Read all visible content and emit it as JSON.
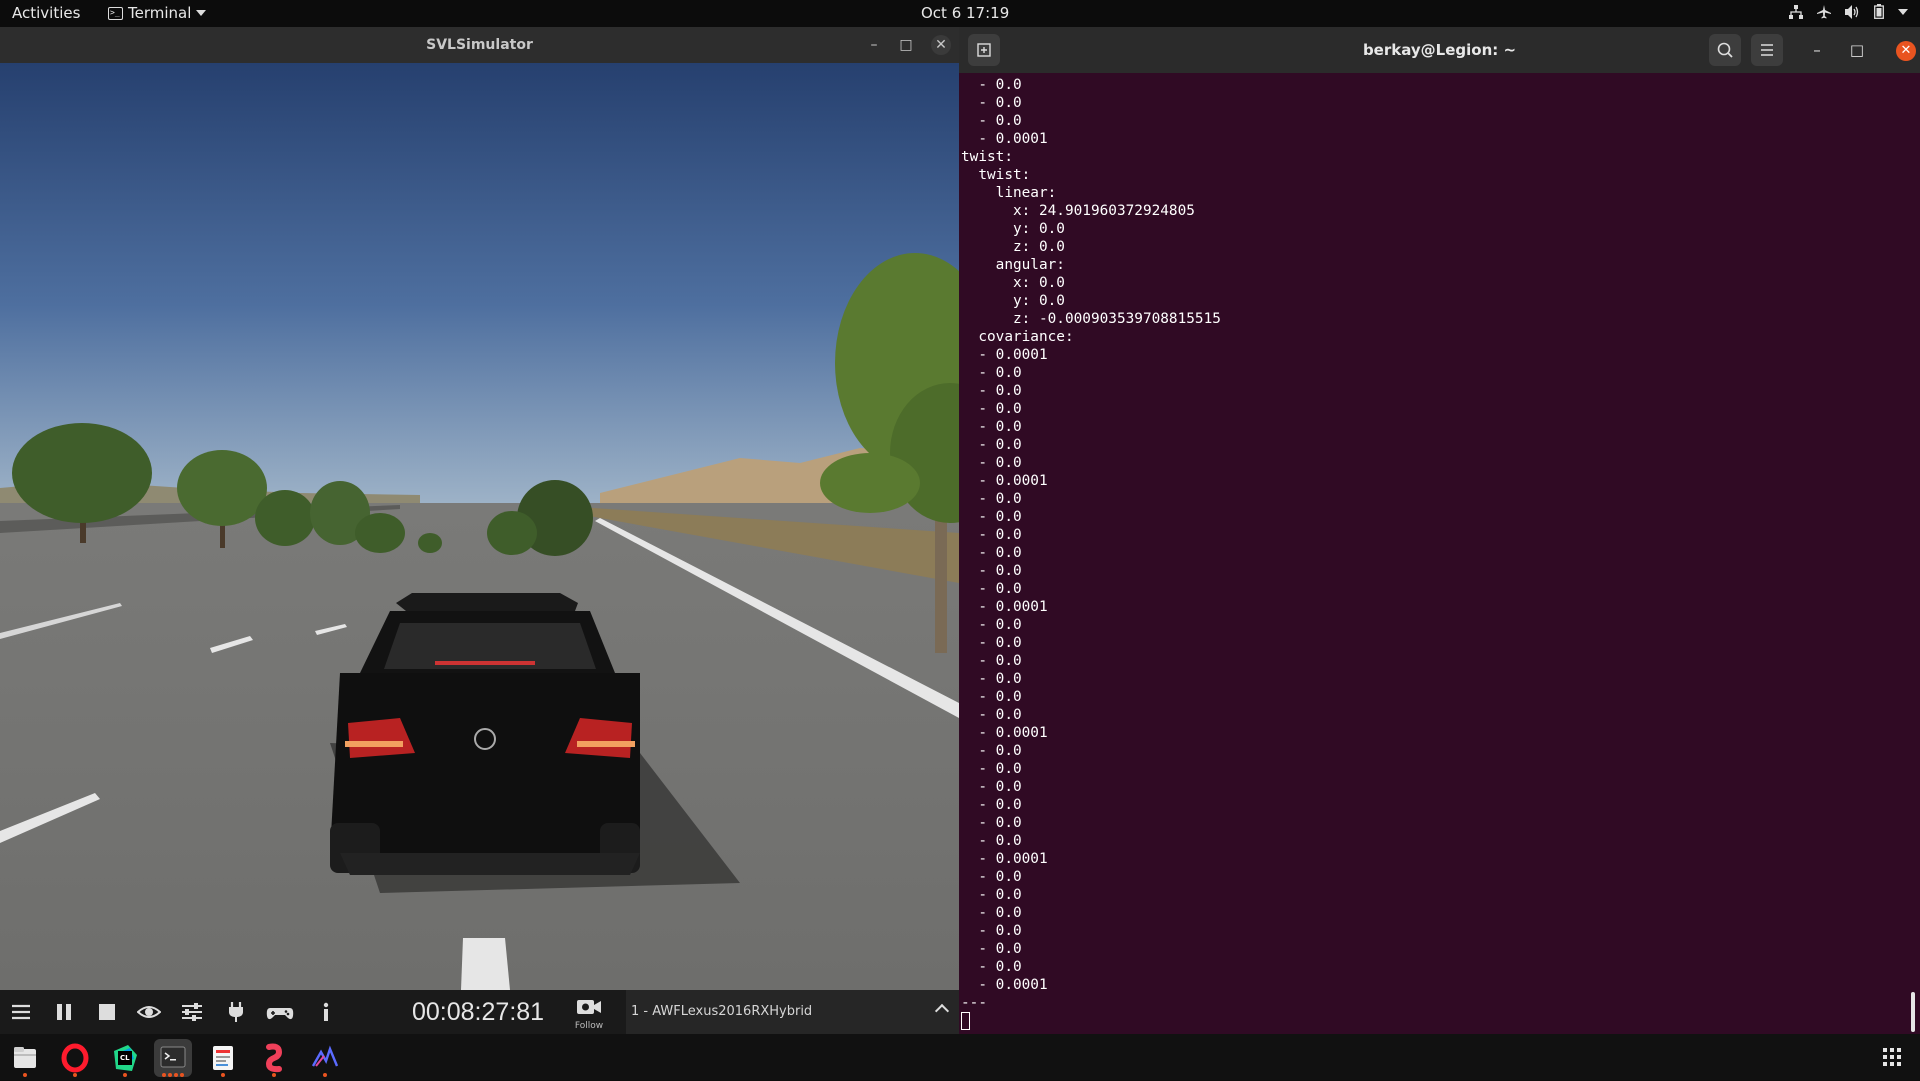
{
  "topbar": {
    "activities": "Activities",
    "app_menu": "Terminal",
    "clock": "Oct 6  17:19",
    "tray_icons": [
      "network-icon",
      "airplane-icon",
      "volume-icon",
      "battery-icon",
      "system-menu-caret"
    ]
  },
  "simulator": {
    "title": "SVLSimulator",
    "timer": "00:08:27:81",
    "follow_label": "Follow",
    "vehicle": "1 - AWFLexus2016RXHybrid",
    "toolbar_icons": [
      "menu-icon",
      "pause-icon",
      "stop-icon",
      "eye-icon",
      "sliders-icon",
      "plug-icon",
      "gamepad-icon",
      "info-icon"
    ]
  },
  "terminal": {
    "title": "berkay@Legion: ~",
    "lines": [
      "  - 0.0",
      "  - 0.0",
      "  - 0.0",
      "  - 0.0001",
      "twist:",
      "  twist:",
      "    linear:",
      "      x: 24.901960372924805",
      "      y: 0.0",
      "      z: 0.0",
      "    angular:",
      "      x: 0.0",
      "      y: 0.0",
      "      z: -0.000903539708815515",
      "  covariance:",
      "  - 0.0001",
      "  - 0.0",
      "  - 0.0",
      "  - 0.0",
      "  - 0.0",
      "  - 0.0",
      "  - 0.0",
      "  - 0.0001",
      "  - 0.0",
      "  - 0.0",
      "  - 0.0",
      "  - 0.0",
      "  - 0.0",
      "  - 0.0",
      "  - 0.0001",
      "  - 0.0",
      "  - 0.0",
      "  - 0.0",
      "  - 0.0",
      "  - 0.0",
      "  - 0.0",
      "  - 0.0001",
      "  - 0.0",
      "  - 0.0",
      "  - 0.0",
      "  - 0.0",
      "  - 0.0",
      "  - 0.0",
      "  - 0.0001",
      "  - 0.0",
      "  - 0.0",
      "  - 0.0",
      "  - 0.0",
      "  - 0.0",
      "  - 0.0",
      "  - 0.0001",
      "---"
    ]
  },
  "dock": {
    "apps": [
      "files-icon",
      "opera-icon",
      "clion-icon",
      "terminal-icon",
      "document-viewer-icon",
      "redis-icon",
      "plotjuggler-icon"
    ],
    "show_apps": "show-applications-icon"
  },
  "colors": {
    "terminal_bg": "#300a24",
    "accent": "#e95420"
  }
}
